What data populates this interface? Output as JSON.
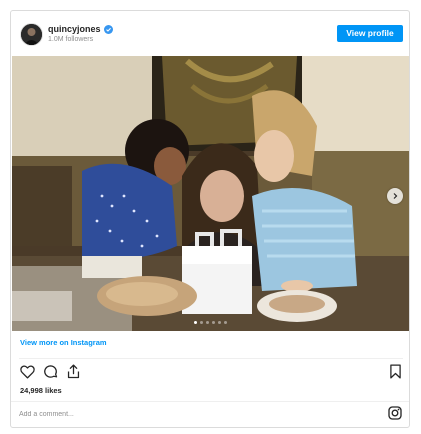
{
  "account": {
    "username": "quincyjones",
    "followers": "1.0M followers",
    "verified_color": "#3897f0"
  },
  "header": {
    "view_profile_label": "View profile",
    "button_color": "#0095f6"
  },
  "post": {
    "image_alt": "Two young children and a woman gathered around a small white box on a table",
    "carousel": {
      "dot_count": 6,
      "active_index": 0
    },
    "view_more_label": "View more on Instagram",
    "likes": "24,998 likes",
    "comment_placeholder": "Add a comment..."
  },
  "icons": {
    "like": "heart-outline-icon",
    "comment": "speech-bubble-icon",
    "share": "share-upload-icon",
    "save": "bookmark-icon",
    "instagram": "instagram-logo-icon",
    "next": "chevron-right-icon"
  }
}
